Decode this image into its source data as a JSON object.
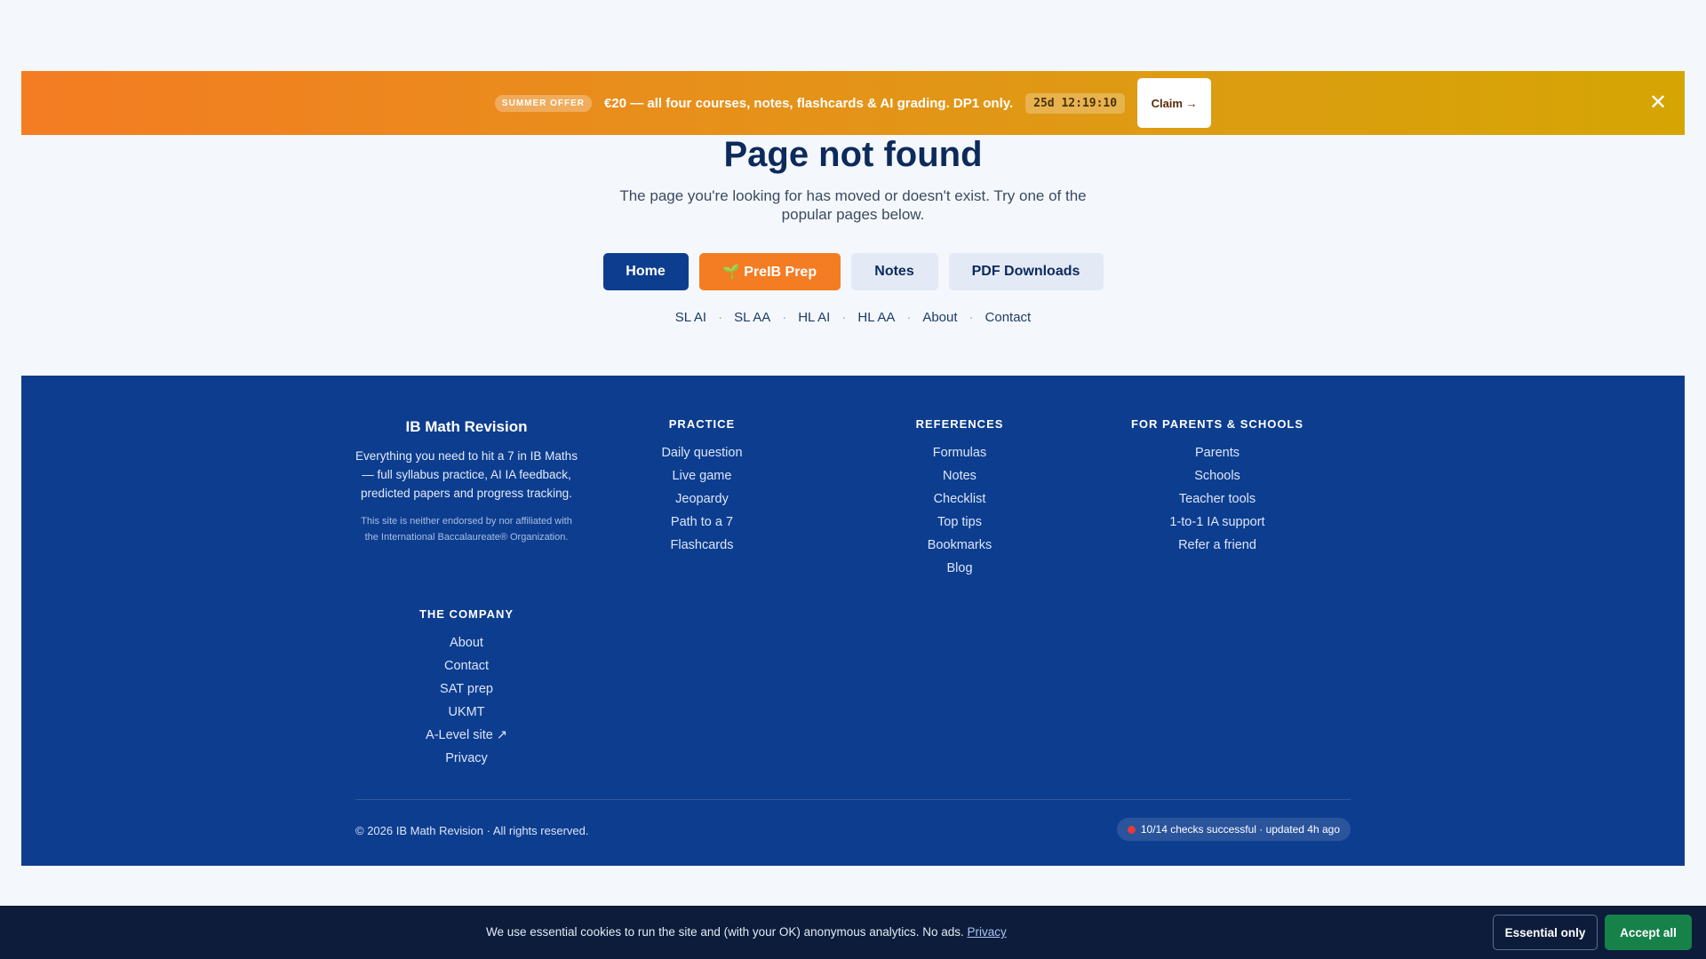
{
  "promo": {
    "badge": "SUMMER OFFER",
    "text": "€20 — all four courses, notes, flashcards & AI grading. DP1 only.",
    "timer": "25d 12:19:10",
    "claim_label": "Claim →",
    "close_symbol": "✕",
    "gradient_start": "#f47c22",
    "gradient_end": "#d5a503"
  },
  "main": {
    "title": "Page not found",
    "subtitle": "The page you're looking for has moved or doesn't exist. Try one of the popular pages below.",
    "buttons": {
      "home": "Home",
      "prep": "🌱 PreIB Prep",
      "notes": "Notes",
      "pdf": "PDF Downloads"
    },
    "quick_links": [
      "SL AI",
      "SL AA",
      "HL AI",
      "HL AA",
      "About",
      "Contact"
    ],
    "separator": "·"
  },
  "footer": {
    "brand": {
      "name": "IB Math Revision",
      "description": "Everything you need to hit a 7 in IB Maths — full syllabus practice, AI IA feedback, predicted papers and progress tracking.",
      "disclaimer": "This site is neither endorsed by nor affiliated with the International Baccalaureate® Organization."
    },
    "practice": {
      "heading": "PRACTICE",
      "items": [
        "Daily question",
        "Live game",
        "Jeopardy",
        "Path to a 7",
        "Flashcards"
      ]
    },
    "references": {
      "heading": "REFERENCES",
      "items": [
        "Formulas",
        "Notes",
        "Checklist",
        "Top tips",
        "Bookmarks",
        "Blog"
      ]
    },
    "parents": {
      "heading": "FOR PARENTS & SCHOOLS",
      "items": [
        "Parents",
        "Schools",
        "Teacher tools",
        "1-to-1 IA support",
        "Refer a friend"
      ]
    },
    "company": {
      "heading": "THE COMPANY",
      "items": [
        "About",
        "Contact",
        "SAT prep",
        "UKMT",
        "A-Level site ↗",
        "Privacy"
      ]
    },
    "copyright": "© 2026 IB Math Revision · All rights reserved.",
    "status": "10/14 checks successful · updated 4h ago",
    "status_color": "#e23b3b",
    "background": "#0d3d8f"
  },
  "cookie": {
    "text": "We use essential cookies to run the site and (with your OK) anonymous analytics. No ads.",
    "privacy_link": "Privacy",
    "essential_label": "Essential only",
    "accept_label": "Accept all",
    "accept_color": "#16824a"
  }
}
